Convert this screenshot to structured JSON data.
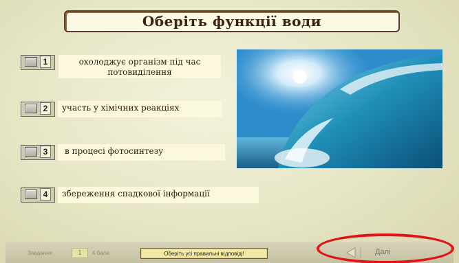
{
  "title": "Оберіть функції води",
  "options": [
    {
      "number": "1",
      "text": "охолоджує організм під час потовиділення"
    },
    {
      "number": "2",
      "text": "участь у хімічних реакціях"
    },
    {
      "number": "3",
      "text": "в процесі фотосинтезу"
    },
    {
      "number": "4",
      "text": "збереження спадкової інформації"
    }
  ],
  "image": {
    "subject": "ocean-wave-photo"
  },
  "footer": {
    "task_label": "Завдання",
    "task_number": "1",
    "points_label": "4 бали.",
    "hint": "Оберіть усі правильні відповіді!",
    "next_label": "Далі"
  },
  "colors": {
    "highlight_oval": "#e11515",
    "title_border": "#5c3d1e",
    "answer_bg": "#fcf8dd"
  }
}
